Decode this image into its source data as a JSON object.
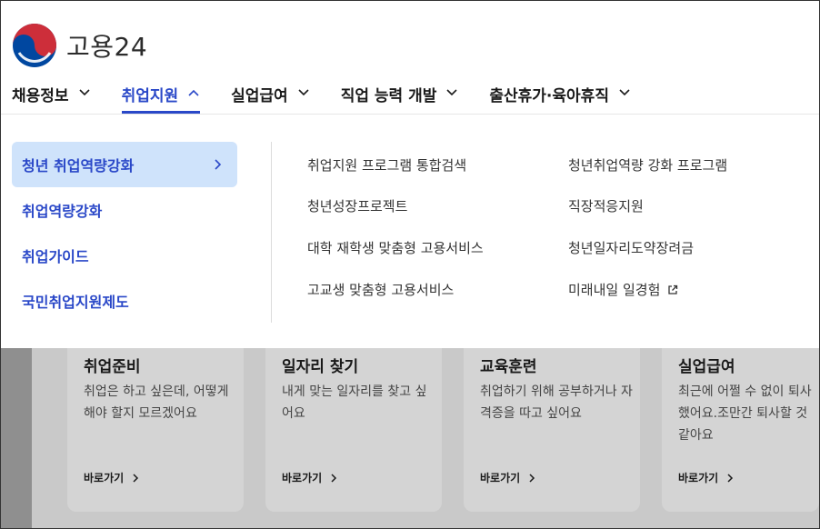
{
  "brand": {
    "name": "고용24"
  },
  "gnb": [
    {
      "label": "채용정보",
      "active": false
    },
    {
      "label": "취업지원",
      "active": true
    },
    {
      "label": "실업급여",
      "active": false
    },
    {
      "label": "직업 능력 개발",
      "active": false
    },
    {
      "label": "출산휴가·육아휴직",
      "active": false
    }
  ],
  "side_menu": [
    {
      "label": "청년 취업역량강화",
      "selected": true
    },
    {
      "label": "취업역량강화",
      "selected": false
    },
    {
      "label": "취업가이드",
      "selected": false
    },
    {
      "label": "국민취업지원제도",
      "selected": false
    }
  ],
  "sub_links": [
    {
      "label": "취업지원 프로그램 통합검색",
      "external": false
    },
    {
      "label": "청년취업역량 강화 프로그램",
      "external": false
    },
    {
      "label": "청년성장프로젝트",
      "external": false
    },
    {
      "label": "직장적응지원",
      "external": false
    },
    {
      "label": "대학 재학생 맞춤형 고용서비스",
      "external": false
    },
    {
      "label": "청년일자리도약장려금",
      "external": false
    },
    {
      "label": "고교생 맞춤형 고용서비스",
      "external": false
    },
    {
      "label": "미래내일 일경험",
      "external": true
    }
  ],
  "cards": [
    {
      "title": "취업준비",
      "desc": "취업은 하고 싶은데, 어떻게 해야 할지 모르겠어요",
      "go": "바로가기"
    },
    {
      "title": "일자리 찾기",
      "desc": "내게 맞는 일자리를 찾고 싶어요",
      "go": "바로가기"
    },
    {
      "title": "교육훈련",
      "desc": "취업하기 위해 공부하거나 자격증을 따고 싶어요",
      "go": "바로가기"
    },
    {
      "title": "실업급여",
      "desc": "최근에 어쩔 수 없이 퇴사했어요.조만간 퇴사할 것 같아요",
      "go": "바로가기"
    }
  ],
  "colors": {
    "accent": "#2a48c8",
    "selected_bg": "#cfe3fb",
    "flag_red": "#cd2e3a",
    "flag_blue": "#0047a0"
  },
  "icons": {
    "logo": "taegeuk-logo-icon",
    "chevron": "chevron-down-icon",
    "arrow": "chevron-right-icon",
    "external": "external-link-icon"
  }
}
